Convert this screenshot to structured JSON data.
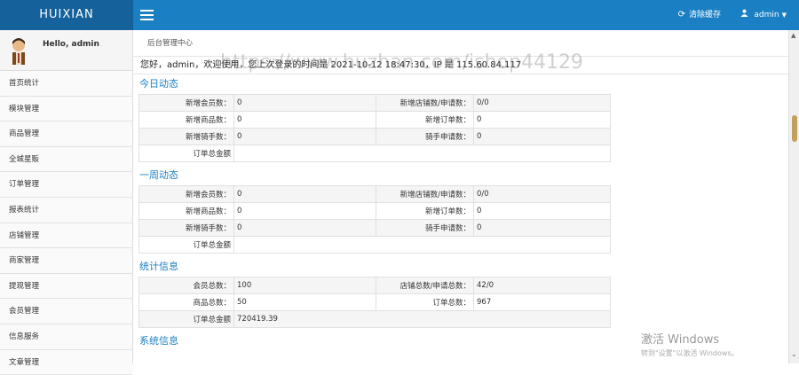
{
  "topbar": {
    "brand": "HUIXIAN",
    "clear_cache": "清除缓存",
    "user": "admin"
  },
  "sidebar": {
    "hello": "Hello, admin",
    "items": [
      "首页统计",
      "模块管理",
      "商品管理",
      "全城星贩",
      "订单管理",
      "报表统计",
      "店铺管理",
      "商家管理",
      "提现管理",
      "会员管理",
      "信息服务",
      "文章管理"
    ]
  },
  "main": {
    "breadcrumb": "后台管理中心",
    "welcome": "您好，admin，欢迎使用，您上次登录的时间是 2021-10-12 18:47:30，IP 是 115.60.84.117"
  },
  "today": {
    "title": "今日动态",
    "new_members_label": "新增会员数：",
    "new_members": "0",
    "new_shops_label": "新增店铺数/申请数：",
    "new_shops": "0/0",
    "new_goods_label": "新增商品数：",
    "new_goods": "0",
    "new_orders_label": "新增订单数：",
    "new_orders": "0",
    "new_riders_label": "新增骑手数：",
    "new_riders": "0",
    "rider_apply_label": "骑手申请数：",
    "rider_apply": "0",
    "order_total_label": "订单总金额"
  },
  "week": {
    "title": "一周动态",
    "new_members_label": "新增会员数：",
    "new_members": "0",
    "new_shops_label": "新增店铺数/申请数：",
    "new_shops": "0/0",
    "new_goods_label": "新增商品数：",
    "new_goods": "0",
    "new_orders_label": "新增订单数：",
    "new_orders": "0",
    "new_riders_label": "新增骑手数：",
    "new_riders": "0",
    "rider_apply_label": "骑手申请数：",
    "rider_apply": "0",
    "order_total_label": "订单总金额"
  },
  "stats": {
    "title": "统计信息",
    "members_label": "会员总数：",
    "members": "100",
    "shops_label": "店铺总数/申请总数：",
    "shops": "42/0",
    "goods_label": "商品总数：",
    "goods": "50",
    "orders_label": "订单总数：",
    "orders": "967",
    "order_total_label": "订单总金额",
    "order_total": "720419.39"
  },
  "system": {
    "title": "系统信息"
  },
  "overlay": {
    "watermark": "https://www.huzhan.com/ishop44129",
    "activate_title": "激活 Windows",
    "activate_sub": "转到\"设置\"以激活 Windows。"
  },
  "colors": {
    "topbar": "#1a7fc3",
    "brand_bg": "#15619c",
    "section_title": "#1a7fc3"
  }
}
